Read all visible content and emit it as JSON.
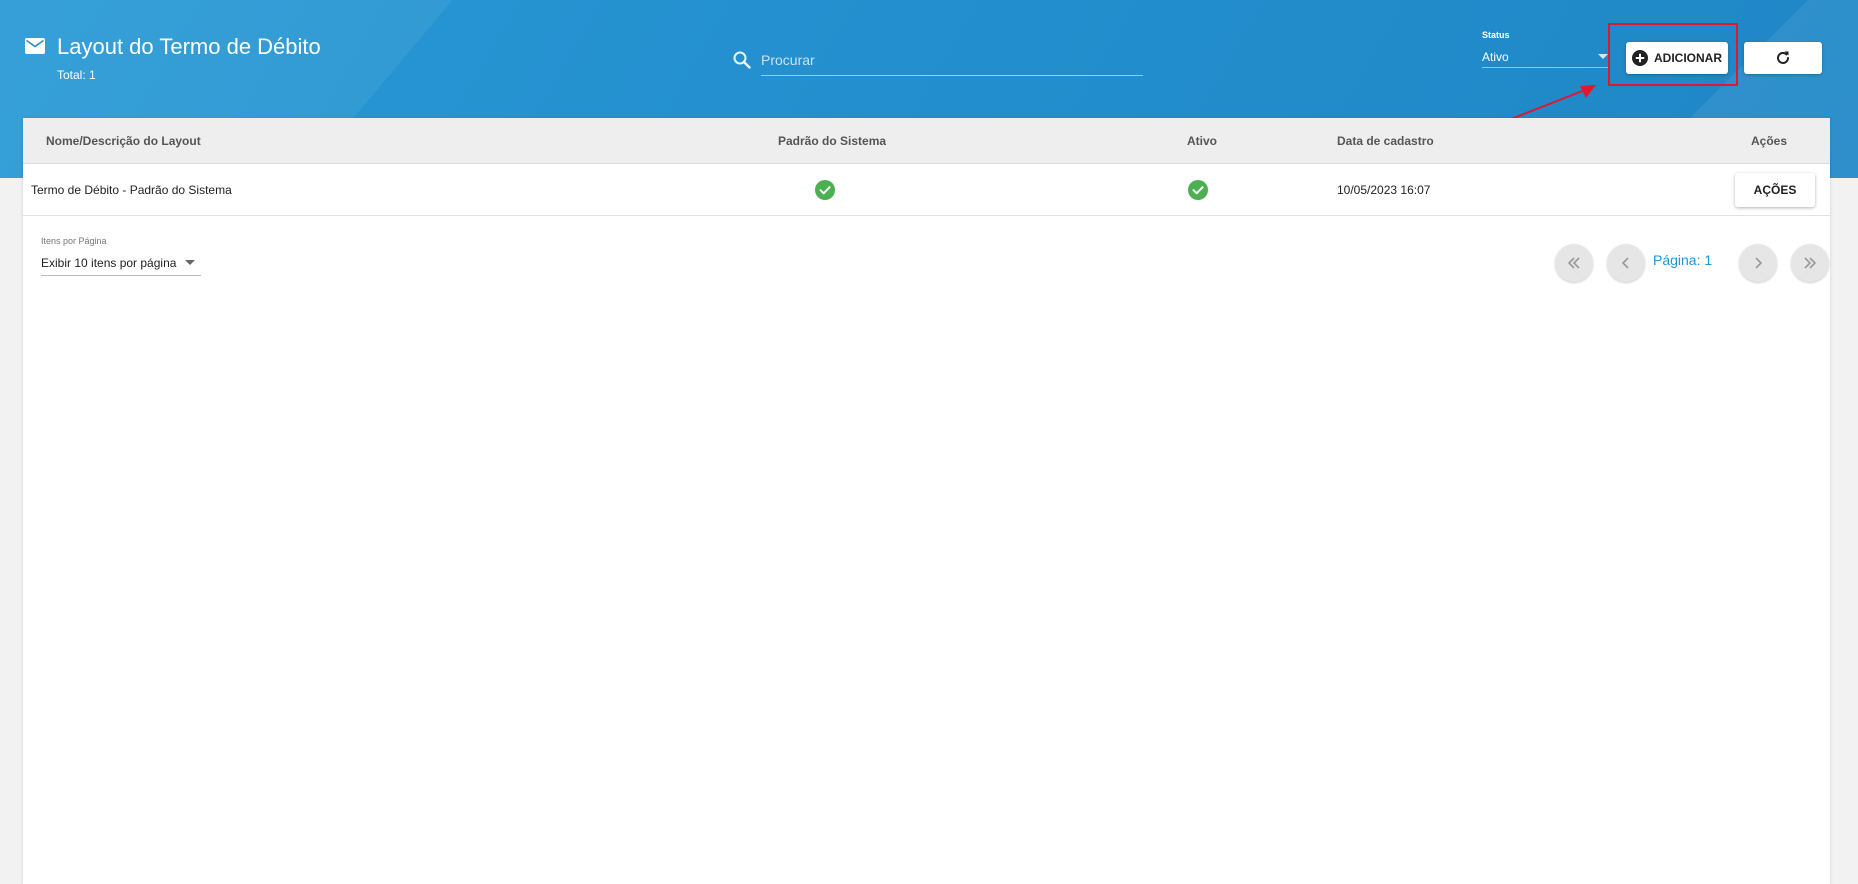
{
  "header": {
    "title": "Layout do Termo de Débito",
    "total": "Total: 1",
    "search_placeholder": "Procurar",
    "status_label": "Status",
    "status_value": "Ativo",
    "add_label": "ADICIONAR"
  },
  "table": {
    "columns": [
      "Nome/Descrição do Layout",
      "Padrão do Sistema",
      "Ativo",
      "Data de cadastro",
      "Ações"
    ],
    "rows": [
      {
        "name": "Termo de Débito - Padrão do Sistema",
        "system_default": "check-icon",
        "active": "check-icon",
        "created": "10/05/2023 16:07",
        "actions_label": "AÇÕES"
      }
    ]
  },
  "footer": {
    "per_page_label": "Itens por Página",
    "per_page_value": "Exibir 10 itens por página",
    "page_label": "Página: 1"
  },
  "colors": {
    "header_blue": "#2490cf",
    "accent": "#1e96d4",
    "check_green": "#4caf50",
    "highlight_red": "#e0182d"
  }
}
